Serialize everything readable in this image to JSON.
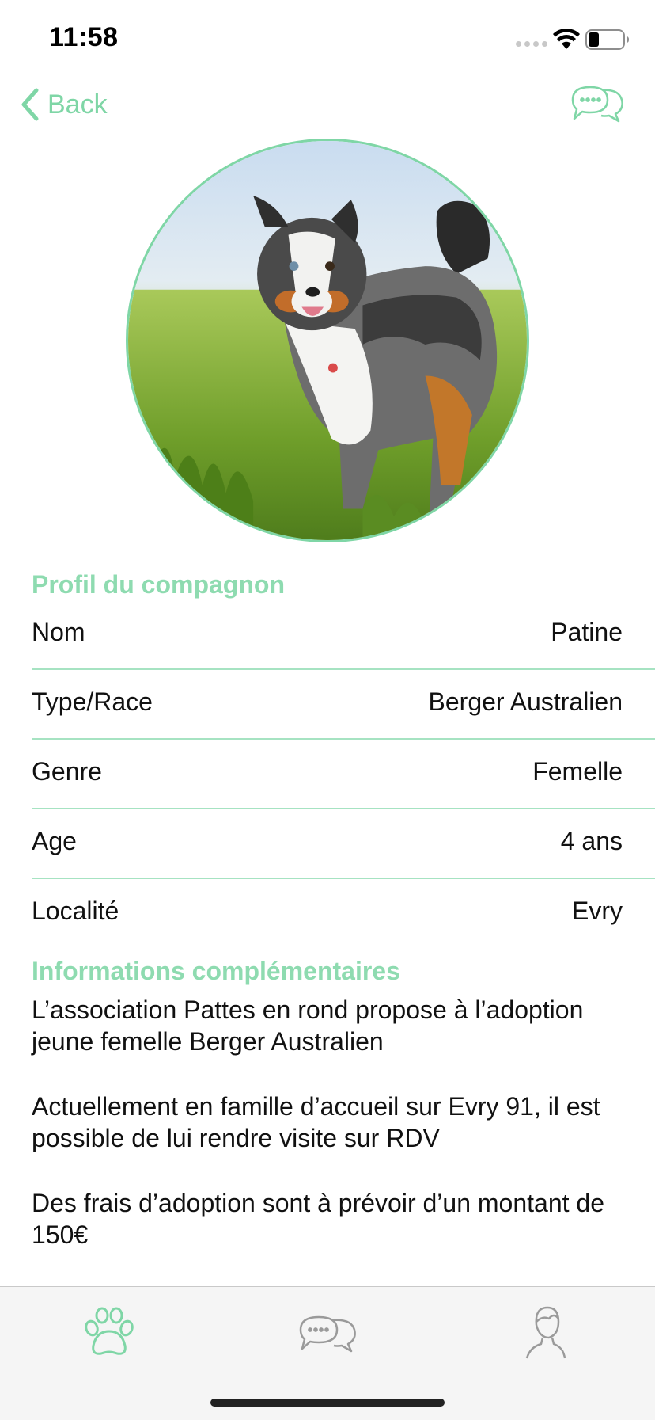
{
  "status_bar": {
    "time": "11:58"
  },
  "nav": {
    "back_label": "Back",
    "icons": {
      "back": "chevron-left-icon",
      "chat": "chat-bubbles-icon"
    }
  },
  "profile": {
    "photo_alt": "Chien Berger Australien",
    "section_title": "Profil du compagnon",
    "fields": [
      {
        "label": "Nom",
        "value": "Patine"
      },
      {
        "label": "Type/Race",
        "value": "Berger Australien"
      },
      {
        "label": "Genre",
        "value": "Femelle"
      },
      {
        "label": "Age",
        "value": "4 ans"
      },
      {
        "label": "Localité",
        "value": "Evry"
      }
    ]
  },
  "extra_info": {
    "title": "Informations complémentaires",
    "paragraphs": [
      "L’association Pattes en rond propose à l’adoption jeune femelle Berger Australien",
      "Actuellement en famille d’accueil sur Evry 91, il est possible de lui rendre visite sur RDV",
      "Des frais d’adoption sont à prévoir d’un montant de 150€"
    ]
  },
  "tab_bar": {
    "tabs": [
      {
        "icon": "paw-icon",
        "active": true
      },
      {
        "icon": "chat-bubbles-icon",
        "active": false
      },
      {
        "icon": "user-profile-icon",
        "active": false
      }
    ]
  },
  "colors": {
    "accent": "#7fd6a6",
    "section_title": "#8edbb0",
    "divider": "#a6e3c2",
    "tab_inactive": "#9a9a9a",
    "tab_bar_bg": "#f5f5f5"
  }
}
